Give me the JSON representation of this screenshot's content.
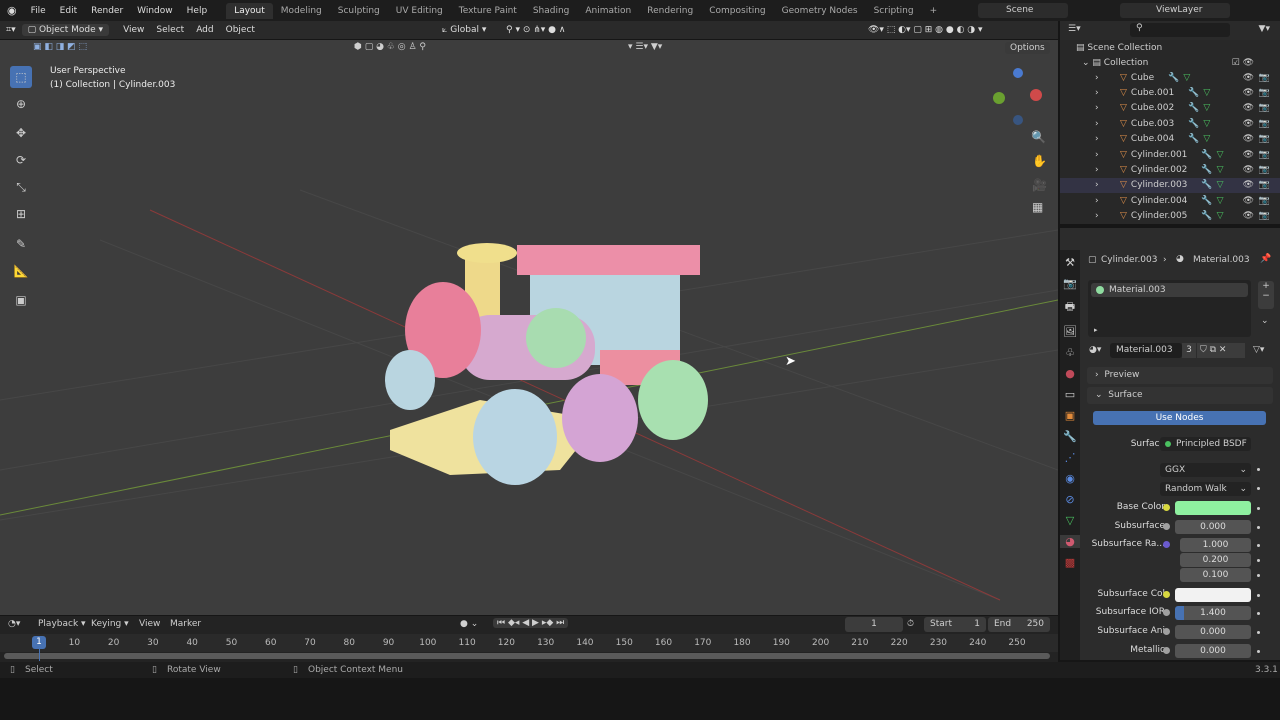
{
  "topbar": {
    "menus": [
      "File",
      "Edit",
      "Render",
      "Window",
      "Help"
    ],
    "workspaces": [
      "Layout",
      "Modeling",
      "Sculpting",
      "UV Editing",
      "Texture Paint",
      "Shading",
      "Animation",
      "Rendering",
      "Compositing",
      "Geometry Nodes",
      "Scripting"
    ],
    "active": "Layout",
    "scene": "Scene",
    "view_layer": "ViewLayer"
  },
  "viewport_header": {
    "mode": "Object Mode",
    "menus": [
      "View",
      "Select",
      "Add",
      "Object"
    ],
    "orientation": "Global",
    "options": "Options"
  },
  "viewport": {
    "perspective": "User Perspective",
    "collection_info": "(1) Collection | Cylinder.003"
  },
  "outliner": {
    "root": "Scene Collection",
    "collection": "Collection",
    "items": [
      "Cube",
      "Cube.001",
      "Cube.002",
      "Cube.003",
      "Cube.004",
      "Cylinder.001",
      "Cylinder.002",
      "Cylinder.003",
      "Cylinder.004",
      "Cylinder.005"
    ]
  },
  "properties": {
    "breadcrumb_object": "Cylinder.003",
    "breadcrumb_material": "Material.003",
    "slot": "Material.003",
    "material_name": "Material.003",
    "users": "3",
    "preview": "Preview",
    "surface_panel": "Surface",
    "use_nodes": "Use Nodes",
    "surface_label": "Surface",
    "surface_value": "Principled BSDF",
    "distribution": "GGX",
    "subsurface_method": "Random Walk",
    "fields": [
      {
        "label": "Base Color",
        "value": "",
        "color": "#8ff0a0"
      },
      {
        "label": "Subsurface",
        "value": "0.000"
      },
      {
        "label": "Subsurface Ra...",
        "value": "1.000"
      },
      {
        "label": "",
        "value": "0.200"
      },
      {
        "label": "",
        "value": "0.100"
      },
      {
        "label": "Subsurface Col",
        "value": "",
        "color": "#f2f2f2"
      },
      {
        "label": "Subsurface IOR",
        "value": "1.400"
      },
      {
        "label": "Subsurface Ani",
        "value": "0.000"
      },
      {
        "label": "Metallic",
        "value": "0.000"
      }
    ]
  },
  "timeline": {
    "menus": [
      "Playback",
      "Keying",
      "View",
      "Marker"
    ],
    "current_frame": "1",
    "start_label": "Start",
    "start": "1",
    "end_label": "End",
    "end": "250",
    "ticks": [
      "1",
      "10",
      "20",
      "30",
      "40",
      "50",
      "60",
      "70",
      "80",
      "90",
      "100",
      "110",
      "120",
      "130",
      "140",
      "150",
      "160",
      "170",
      "180",
      "190",
      "200",
      "210",
      "220",
      "230",
      "240",
      "250"
    ]
  },
  "statusbar": {
    "select": "Select",
    "rotate": "Rotate View",
    "context": "Object Context Menu",
    "version": "3.3.1"
  }
}
